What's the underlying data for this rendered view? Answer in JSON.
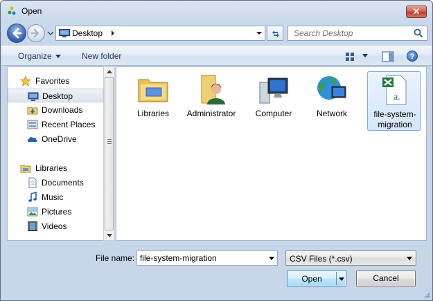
{
  "window": {
    "title": "Open",
    "close_label": "✕"
  },
  "address_bar": {
    "location": "Desktop",
    "search_placeholder": "Search Desktop"
  },
  "toolbar": {
    "organize_label": "Organize",
    "new_folder_label": "New folder",
    "help_label": "?"
  },
  "nav_pane": {
    "favorites_label": "Favorites",
    "favorites": [
      {
        "label": "Desktop",
        "icon": "desktop-icon",
        "selected": true
      },
      {
        "label": "Downloads",
        "icon": "downloads-icon"
      },
      {
        "label": "Recent Places",
        "icon": "recent-places-icon"
      },
      {
        "label": "OneDrive",
        "icon": "onedrive-icon"
      }
    ],
    "libraries_label": "Libraries",
    "libraries": [
      {
        "label": "Documents",
        "icon": "documents-icon"
      },
      {
        "label": "Music",
        "icon": "music-icon"
      },
      {
        "label": "Pictures",
        "icon": "pictures-icon"
      },
      {
        "label": "Videos",
        "icon": "videos-icon"
      }
    ]
  },
  "content": {
    "items": [
      {
        "name": "Libraries",
        "icon": "libraries-folder-icon"
      },
      {
        "name": "Administrator",
        "icon": "user-folder-icon"
      },
      {
        "name": "Computer",
        "icon": "computer-icon"
      },
      {
        "name": "Network",
        "icon": "network-icon"
      },
      {
        "name": "file-system-migration",
        "icon": "csv-file-icon",
        "selected": true
      }
    ]
  },
  "bottom": {
    "file_name_label": "File name:",
    "file_name_value": "file-system-migration",
    "file_type_filter": "CSV Files (*.csv)",
    "open_label": "Open",
    "cancel_label": "Cancel"
  },
  "colors": {
    "accent": "#3768b8",
    "selection": "#d3e6fb",
    "close_button": "#c23a2c"
  }
}
